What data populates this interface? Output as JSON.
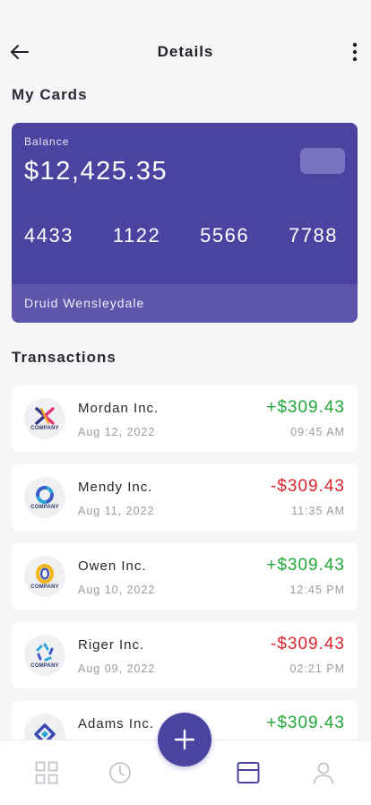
{
  "header": {
    "title": "Details",
    "back_icon": "arrow-left-icon",
    "more_icon": "more-vertical-icon"
  },
  "cards_section": {
    "title": "My Cards"
  },
  "card": {
    "balance_label": "Balance",
    "balance_value": "$12,425.35",
    "numbers": [
      "4433",
      "1122",
      "5566",
      "7788"
    ],
    "holder": "Druid Wensleydale",
    "color": "#4b43a0"
  },
  "transactions_section": {
    "title": "Transactions"
  },
  "transactions": [
    {
      "name": "Mordan Inc.",
      "date": "Aug 12, 2022",
      "amount": "+$309.43",
      "time": "09:45 AM",
      "logo_text": "COMPANY",
      "type": "credit"
    },
    {
      "name": "Mendy Inc.",
      "date": "Aug 11, 2022",
      "amount": "-$309.43",
      "time": "11:35 AM",
      "logo_text": "COMPANY",
      "type": "debit"
    },
    {
      "name": "Owen Inc.",
      "date": "Aug 10, 2022",
      "amount": "+$309.43",
      "time": "12:45 PM",
      "logo_text": "COMPANY",
      "type": "credit"
    },
    {
      "name": "Riger Inc.",
      "date": "Aug 09, 2022",
      "amount": "-$309.43",
      "time": "02:21 PM",
      "logo_text": "COMPANY",
      "type": "debit"
    },
    {
      "name": "Adams Inc.",
      "date": "",
      "amount": "+$309.43",
      "time": "",
      "logo_text": "",
      "type": "credit"
    }
  ],
  "colors": {
    "credit": "#21a838",
    "debit": "#d9262c",
    "accent": "#4b43a0"
  },
  "bottom_nav": {
    "items": [
      "grid-icon",
      "clock-icon",
      "card-icon",
      "user-icon"
    ],
    "active": "card-icon",
    "fab_icon": "plus-icon"
  }
}
